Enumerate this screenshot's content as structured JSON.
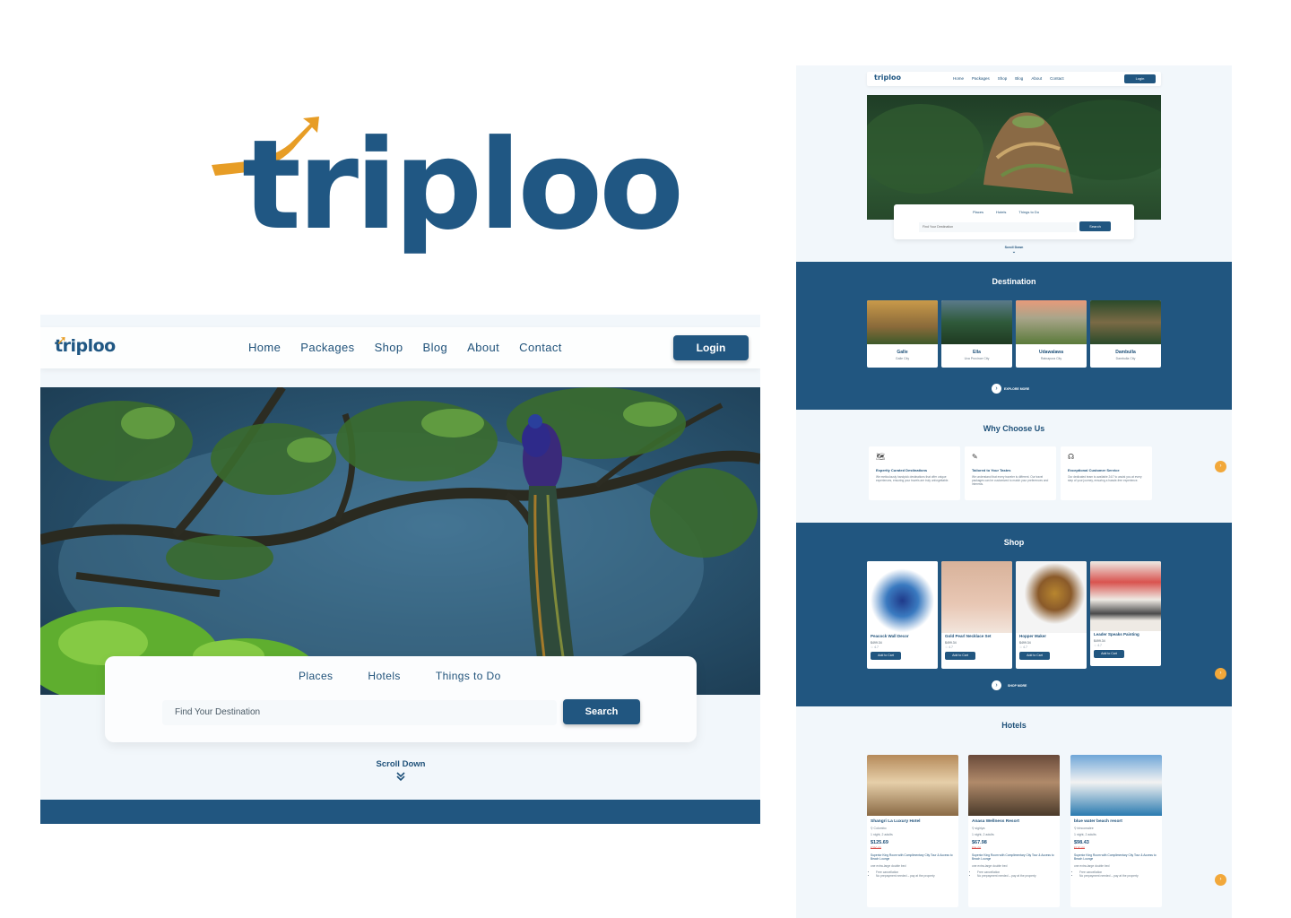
{
  "brand": {
    "logo_text": "triploo",
    "colors": {
      "primary": "#215680",
      "accent": "#e79d26",
      "background": "#f2f7fb"
    }
  },
  "nav": {
    "logo": "triploo",
    "links": [
      "Home",
      "Packages",
      "Shop",
      "Blog",
      "About",
      "Contact"
    ],
    "login_label": "Login"
  },
  "search": {
    "tabs": [
      "Places",
      "Hotels",
      "Things to Do"
    ],
    "placeholder": "Find Your Destination",
    "button_label": "Search"
  },
  "scroll_label": "Scroll Down",
  "preview": {
    "nav": {
      "logo": "triploo",
      "links": [
        "Home",
        "Packages",
        "Shop",
        "Blog",
        "About",
        "Contact"
      ],
      "login_label": "Login"
    },
    "search": {
      "tabs": [
        "Places",
        "Hotels",
        "Things to Do"
      ],
      "placeholder": "Find Your Destination",
      "button_label": "Search"
    },
    "scroll_label": "Scroll Down",
    "destination": {
      "title": "Destination",
      "cards": [
        {
          "name": "Galle",
          "sub": "Galle City"
        },
        {
          "name": "Ella",
          "sub": "Uva Province City"
        },
        {
          "name": "Udawalawa",
          "sub": "Ratnapura City"
        },
        {
          "name": "Dambulla",
          "sub": "Dambulla City"
        }
      ],
      "more_label": "EXPLORE MORE"
    },
    "why": {
      "title": "Why Choose Us",
      "cards": [
        {
          "icon": "map-icon",
          "title": "Expertly Curated Destinations",
          "desc": "We meticulously handpick destinations that offer unique experiences, ensuring your travels are truly unforgettable."
        },
        {
          "icon": "pencil-icon",
          "title": "Tailored to Your Tastes",
          "desc": "We understand that every traveler is different. Our travel packages can be customized to match your preferences and interests."
        },
        {
          "icon": "headset-icon",
          "title": "Exceptional Customer Service",
          "desc": "Our dedicated team is available 24/7 to assist you at every step of your journey, ensuring a hassle-free experience."
        }
      ]
    },
    "shop": {
      "title": "Shop",
      "items": [
        {
          "name": "Peacock Wall Decor",
          "price": "$499.34",
          "rating": "4.7",
          "button": "Add to Cart"
        },
        {
          "name": "Gold Pearl Necklace Set",
          "price": "$499.34",
          "rating": "4.7",
          "button": "Add to Cart"
        },
        {
          "name": "Hopper Maker",
          "price": "$499.34",
          "rating": "4.7",
          "button": "Add to Cart"
        },
        {
          "name": "Leader Speaks Painting",
          "price": "$499.34",
          "rating": "4.7",
          "button": "Add to Cart"
        }
      ],
      "more_label": "SHOP MORE"
    },
    "hotels": {
      "title": "Hotels",
      "items": [
        {
          "name": "Shangri La Luxury Hotel",
          "location": "Colombo",
          "nights": "1 night, 2 adults",
          "price": "$125.69",
          "old_price": "$250.00",
          "room": "Superior King Room with Complimentary City Tour & Access to Beach Lounge",
          "bed": "one extra-large double bed",
          "perks": [
            "Free cancellation",
            "No prepayment needed – pay at the property"
          ]
        },
        {
          "name": "Anasa Wellness Resort",
          "location": "sigiriya",
          "nights": "1 night, 2 adults",
          "price": "$67.98",
          "old_price": "$94.00",
          "room": "Superior King Room with Complimentary City Tour & Access to Beach Lounge",
          "bed": "one extra-large double bed",
          "perks": [
            "Free cancellation",
            "No prepayment needed – pay at the property"
          ]
        },
        {
          "name": "blue water beach resort",
          "location": "trincomalee",
          "nights": "1 night, 2 adults",
          "price": "$98.43",
          "old_price": "$130.00",
          "room": "Superior King Room with Complimentary City Tour & Access to Beach Lounge",
          "bed": "one extra-large double bed",
          "perks": [
            "Free cancellation",
            "No prepayment needed – pay at the property"
          ]
        }
      ]
    }
  }
}
